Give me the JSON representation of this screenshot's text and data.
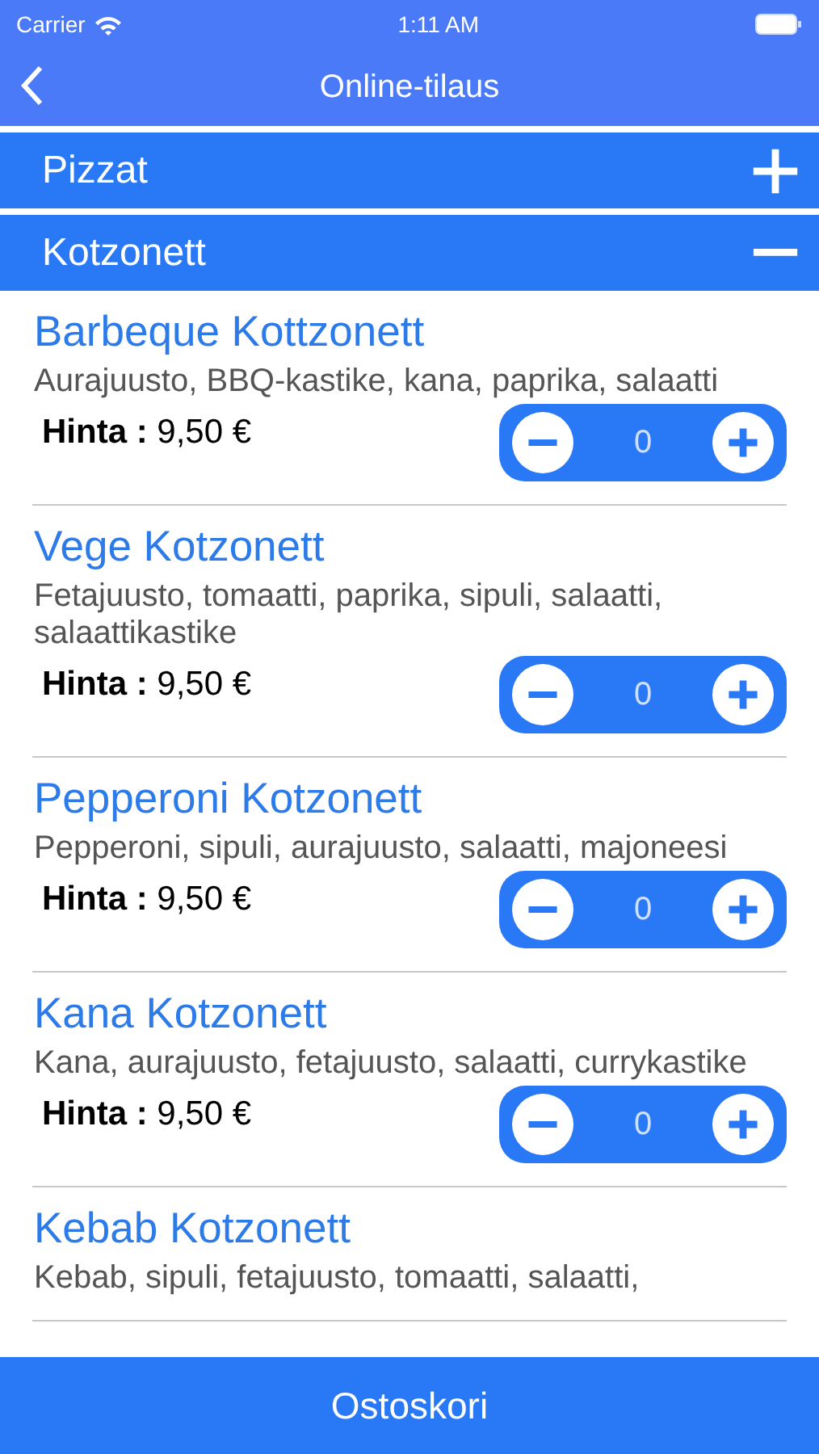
{
  "status_bar": {
    "carrier": "Carrier",
    "time": "1:11 AM"
  },
  "nav": {
    "title": "Online-tilaus"
  },
  "sections": [
    {
      "title": "Pizzat",
      "expanded": false
    },
    {
      "title": "Kotzonett",
      "expanded": true
    }
  ],
  "products": [
    {
      "name": "Barbeque Kottzonett",
      "description": "Aurajuusto, BBQ-kastike, kana, paprika, salaatti",
      "price_label": "Hinta :",
      "price": "9,50 €",
      "quantity": "0"
    },
    {
      "name": "Vege Kotzonett",
      "description": "Fetajuusto, tomaatti, paprika, sipuli, salaatti, salaattikastike",
      "price_label": "Hinta :",
      "price": "9,50 €",
      "quantity": "0"
    },
    {
      "name": "Pepperoni Kotzonett",
      "description": "Pepperoni, sipuli, aurajuusto, salaatti, majoneesi",
      "price_label": "Hinta :",
      "price": "9,50 €",
      "quantity": "0"
    },
    {
      "name": "Kana Kotzonett",
      "description": "Kana, aurajuusto, fetajuusto, salaatti, currykastike",
      "price_label": "Hinta :",
      "price": "9,50 €",
      "quantity": "0"
    },
    {
      "name": "Kebab Kotzonett",
      "description": "Kebab, sipuli, fetajuusto, tomaatti, salaatti,"
    }
  ],
  "footer": {
    "label": "Ostoskori"
  }
}
